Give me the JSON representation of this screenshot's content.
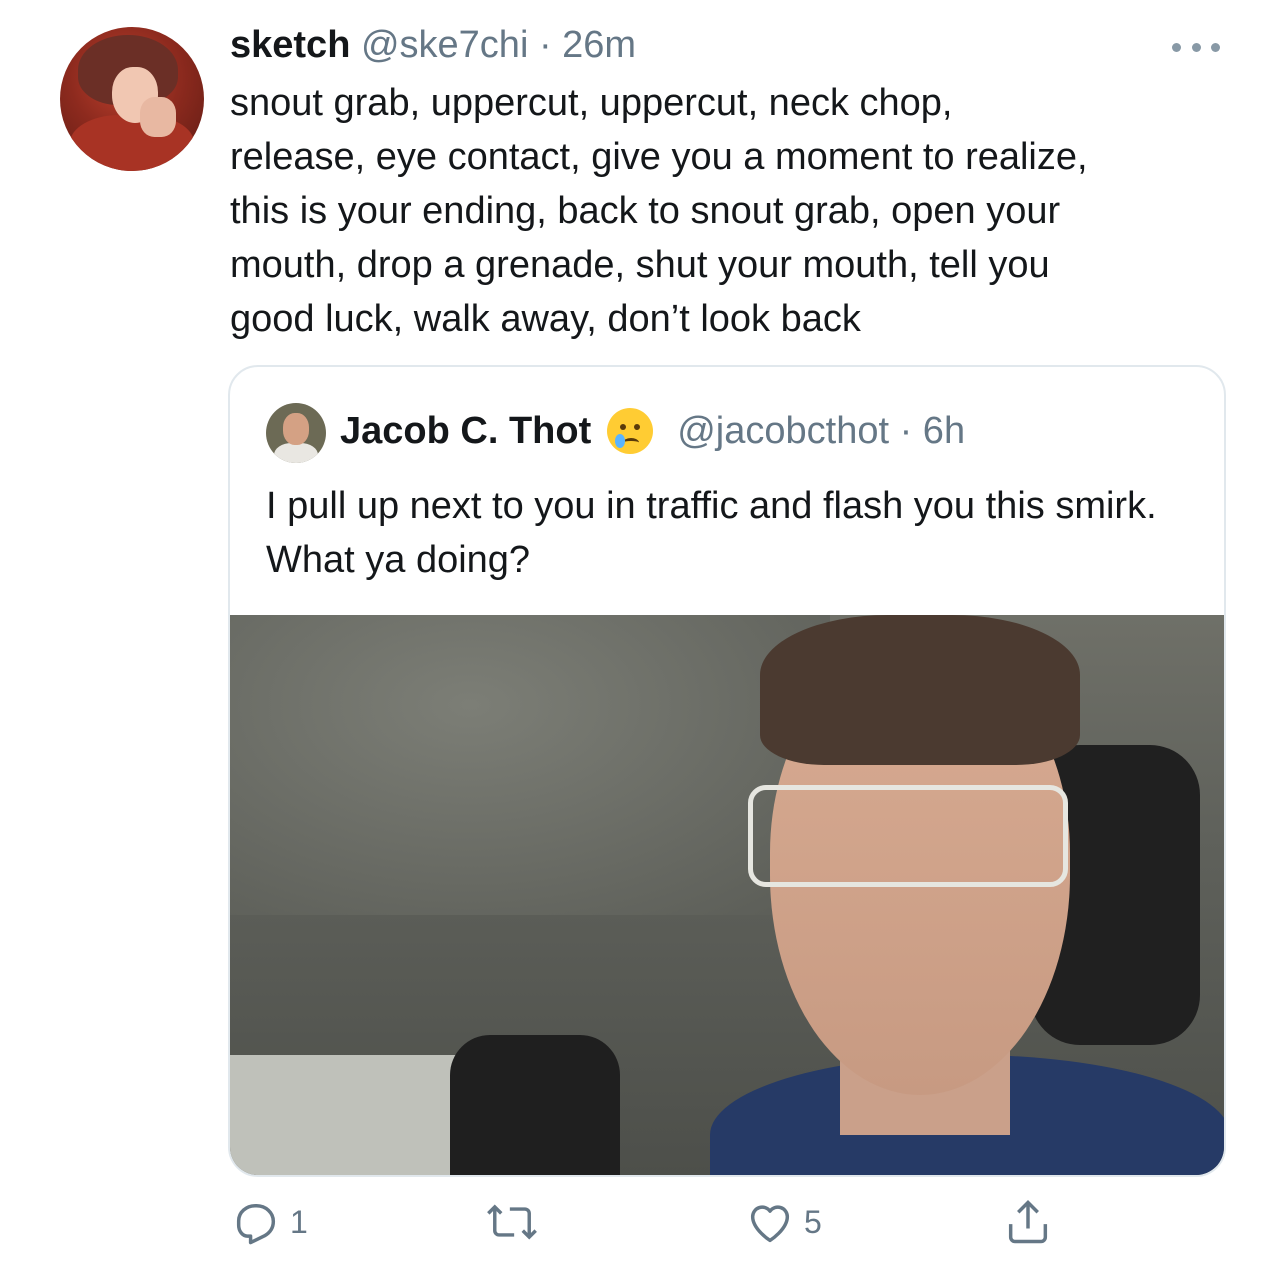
{
  "tweet": {
    "author_name": "sketch",
    "handle_time": "@ske7chi · 26m",
    "text": "snout grab, uppercut, uppercut, neck chop,\nrelease, eye contact, give you a moment to realize,\nthis is your ending, back to snout grab, open your\nmouth, drop a grenade, shut your mouth, tell you\ngood luck, walk away, don’t look back"
  },
  "quoted": {
    "author_name": "Jacob C. Thot",
    "handle_time": "@jacobcthot · 6h",
    "text": "I pull up next to you in traffic and flash you this smirk. What ya doing?"
  },
  "actions": {
    "reply_count": "1",
    "like_count": "5"
  },
  "icons": {
    "more": "more-horizontal-icon",
    "reply": "reply-icon",
    "retweet": "retweet-icon",
    "like": "heart-icon",
    "share": "share-icon"
  },
  "colors": {
    "secondary_text": "#657786",
    "border": "#e1e8ed",
    "primary_text": "#14171a"
  }
}
